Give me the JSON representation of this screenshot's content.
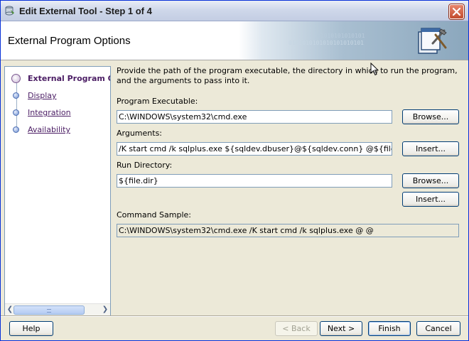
{
  "window": {
    "title": "Edit External Tool - Step 1 of 4"
  },
  "header": {
    "title": "External Program Options",
    "banner_bits_1": "0101010101010101010101",
    "banner_bits_2": "01010101010101"
  },
  "nav": {
    "items": [
      {
        "label": "External Program Options",
        "active": true
      },
      {
        "label": "Display",
        "active": false
      },
      {
        "label": "Integration",
        "active": false
      },
      {
        "label": "Availability",
        "active": false
      }
    ]
  },
  "main": {
    "description": "Provide the path of the program executable, the directory in which to run the program, and the arguments to pass into it.",
    "program_executable": {
      "label": "Program Executable:",
      "value": "C:\\WINDOWS\\system32\\cmd.exe",
      "button": "Browse..."
    },
    "arguments": {
      "label": "Arguments:",
      "value": "/K start cmd /k sqlplus.exe ${sqldev.dbuser}@${sqldev.conn} @${file.path}",
      "button": "Insert..."
    },
    "run_directory": {
      "label": "Run Directory:",
      "value": "${file.dir}",
      "browse_button": "Browse...",
      "insert_button": "Insert..."
    },
    "command_sample": {
      "label": "Command Sample:",
      "value": "C:\\WINDOWS\\system32\\cmd.exe /K start cmd /k sqlplus.exe @ @"
    }
  },
  "footer": {
    "help": "Help",
    "back": "< Back",
    "next": "Next >",
    "finish": "Finish",
    "cancel": "Cancel"
  },
  "colors": {
    "nav_active_text": "#4b1d64",
    "title_bar_close": "#c24d2f"
  }
}
